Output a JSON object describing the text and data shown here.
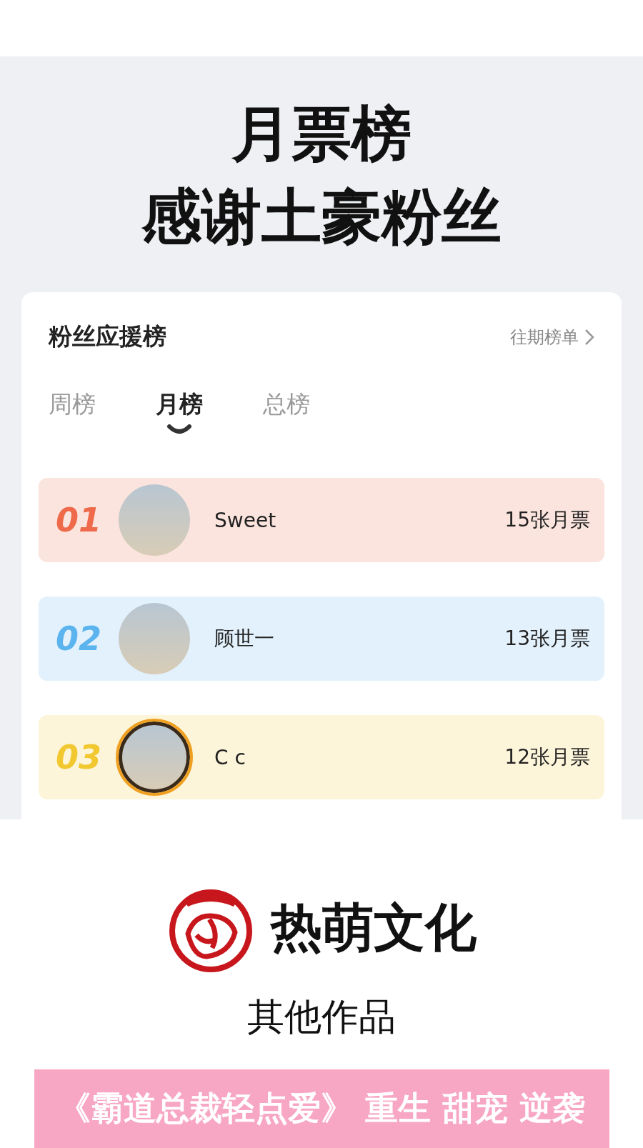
{
  "headline": [
    "月票榜",
    "感谢土豪粉丝"
  ],
  "card": {
    "title": "粉丝应援榜",
    "history_link": "往期榜单",
    "tabs": [
      {
        "label": "周榜",
        "selected": false
      },
      {
        "label": "月榜",
        "selected": true
      },
      {
        "label": "总榜",
        "selected": false
      }
    ],
    "rows": [
      {
        "rank": "01",
        "name": "Sweet",
        "votes": "15张月票",
        "color": "#ee6a4a",
        "framed": false
      },
      {
        "rank": "02",
        "name": "顾世一",
        "votes": "13张月票",
        "color": "#5cb4ee",
        "framed": false
      },
      {
        "rank": "03",
        "name": "C c",
        "votes": "12张月票",
        "color": "#f2c830",
        "framed": true
      }
    ]
  },
  "brand": "热萌文化",
  "other_works_title": "其他作品",
  "banner": "《霸道总裁轻点爱》 重生 甜宠 逆袭"
}
